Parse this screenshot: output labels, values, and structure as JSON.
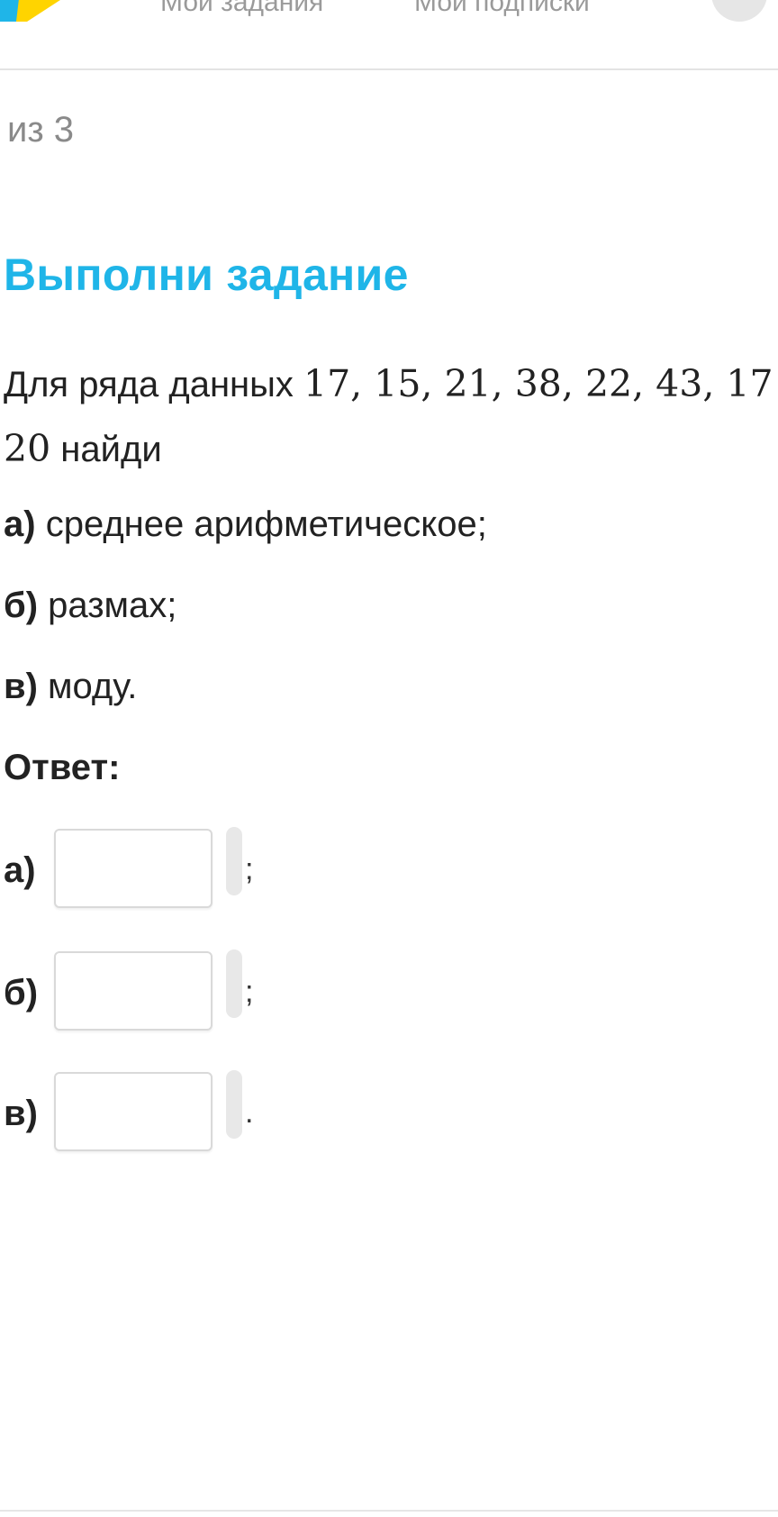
{
  "header": {
    "nav_tasks_label": "Мои задания",
    "nav_subscriptions_label": "Мои подписки"
  },
  "counter_text": "из 3",
  "task": {
    "title": "Выполни задание",
    "prefix": "Для ряда данных",
    "numbers_line1": "17, 15, 21, 38, 22, 43, 17",
    "numbers_line2": "20",
    "suffix": "найди",
    "items": [
      {
        "letter": "а)",
        "text": "среднее арифметическое;"
      },
      {
        "letter": "б)",
        "text": "размах;"
      },
      {
        "letter": "в)",
        "text": "моду."
      }
    ]
  },
  "answer": {
    "label": "Ответ:",
    "rows": [
      {
        "letter": "а)",
        "value": "",
        "punct": ";"
      },
      {
        "letter": "б)",
        "value": "",
        "punct": ";"
      },
      {
        "letter": "в)",
        "value": "",
        "punct": "."
      }
    ]
  },
  "colors": {
    "title": "#1fb5e8",
    "logo_blue": "#1fb5e8",
    "logo_yellow": "#ffd400"
  },
  "icons": {
    "logo": "app-logo-icon",
    "avatar": "avatar-button"
  }
}
